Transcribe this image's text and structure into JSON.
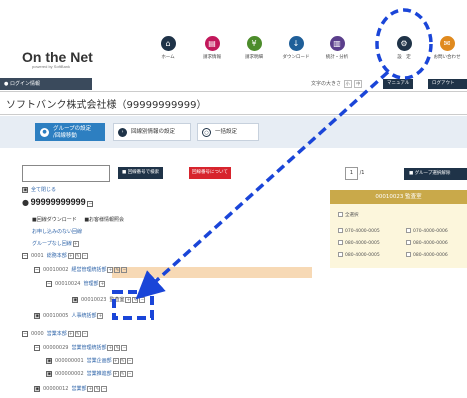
{
  "brand": {
    "logo": "On the Net",
    "tagline": "powered by SoftBank"
  },
  "nav": [
    {
      "label": "ホーム",
      "icon": "home-icon",
      "color": "#1f3348"
    },
    {
      "label": "請求情報",
      "icon": "invoice-icon",
      "color": "#c2185b"
    },
    {
      "label": "請求明細",
      "icon": "yen-icon",
      "color": "#4c8c2b"
    },
    {
      "label": "ダウンロード",
      "icon": "download-icon",
      "color": "#1f5f99"
    },
    {
      "label": "統計・分析",
      "icon": "chart-icon",
      "color": "#5b3f8c"
    },
    {
      "label": "設　定",
      "icon": "gear-icon",
      "color": "#1f3348"
    },
    {
      "label": "お問い合わせ",
      "icon": "mail-icon",
      "color": "#e08a1e"
    }
  ],
  "subbar": {
    "login_info": "ログイン情報",
    "font_size_label": "文字の大きさ",
    "font_size_buttons": [
      "小",
      "中"
    ],
    "manual": "マニュアル",
    "logout": "ログアウト"
  },
  "company_name": "ソフトバンク株式会社様（99999999999）",
  "tabs": [
    {
      "label_line1": "グループの設定",
      "label_line2": "/回線移動",
      "active": true
    },
    {
      "label": "回線別情報の設定",
      "active": false
    },
    {
      "label": "一括設定",
      "active": false
    }
  ],
  "search": {
    "value": "",
    "button": "回線番号で検索",
    "red_button": "回線番号について"
  },
  "tree": {
    "collapse_all": "全て閉じる",
    "root_number": "99999999999",
    "root_toggle": "－",
    "bulk_download": "■回線ダウンロード",
    "affiliated": "■お客様情報照会",
    "unassigned_pending": "お申し込みのない回線",
    "no_group": "グループなし回線",
    "nodes": [
      {
        "code": "0001",
        "name": "総務本部"
      },
      {
        "code": "00010002",
        "name": "経営管理統括部"
      },
      {
        "code": "00010024",
        "name": "管理部"
      },
      {
        "code": "00010023",
        "name": "監査室"
      },
      {
        "code": "00010005",
        "name": "人事統括部"
      },
      {
        "code": "0000",
        "name": "営業本部"
      },
      {
        "code": "00000029",
        "name": "営業管理統括部"
      },
      {
        "code": "000000001",
        "name": "営業企画部"
      },
      {
        "code": "000000002",
        "name": "営業推進部"
      },
      {
        "code": "00000012",
        "name": "営業部"
      }
    ]
  },
  "pager": {
    "current": "1",
    "total": "/1"
  },
  "group_select_button": "グループ選択解除",
  "panel": {
    "title": "00010023 監査室",
    "select_all": "全選択",
    "lines": [
      "070-4000-0005",
      "070-4000-0006",
      "080-4000-0005",
      "080-4000-0006",
      "080-4000-0005",
      "080-4000-0006"
    ]
  },
  "colors": {
    "accent": "#2d7fc1",
    "annotation": "#1a45d8",
    "dark": "#1f3348",
    "panel_header": "#c9a94a",
    "highlight": "#f7d9b5"
  }
}
